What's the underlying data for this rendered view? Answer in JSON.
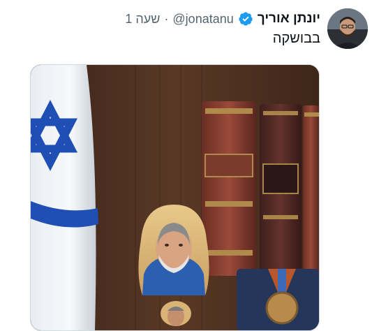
{
  "tweet": {
    "author_name": "יונתן אוריך",
    "handle": "@jonatanu",
    "separator": "·",
    "time": "שעה 1",
    "text": "בבושקה"
  },
  "icons": {
    "verified": "verified-badge-icon",
    "avatar": "profile-photo"
  },
  "colors": {
    "verified_blue": "#1d9bf0",
    "text_primary": "#0f1419",
    "text_secondary": "#536471",
    "flag_blue": "#1f4fb4"
  }
}
